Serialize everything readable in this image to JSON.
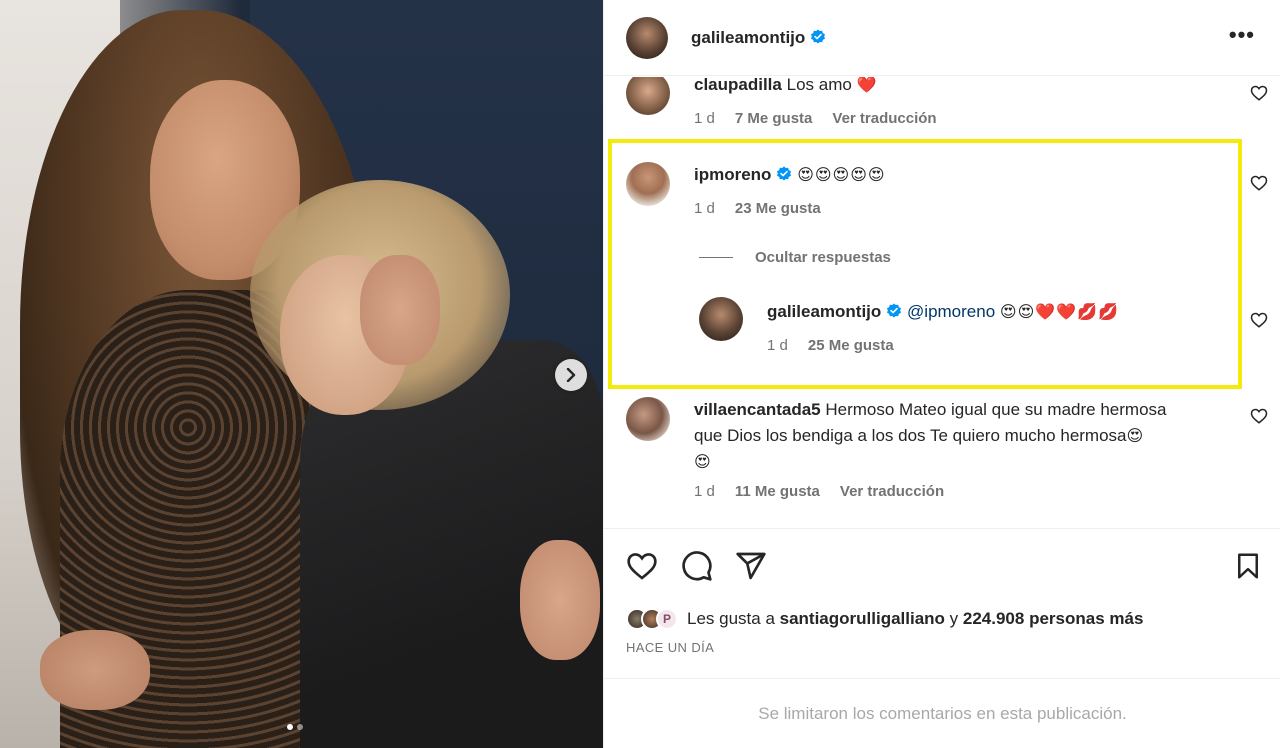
{
  "post": {
    "image_alt": "Photo of woman hugging child",
    "carousel_total": 2,
    "carousel_index": 1
  },
  "header": {
    "username": "galileamontijo",
    "verified": true,
    "more_label": "•••"
  },
  "comments": [
    {
      "username": "claupadilla",
      "text": "Los amo ",
      "emoji": "❤️",
      "age": "1 d",
      "likes": "7 Me gusta",
      "translate": "Ver traducción"
    },
    {
      "username": "ipmoreno",
      "verified": true,
      "text": "",
      "emoji": "😍😍😍😍😍",
      "age": "1 d",
      "likes": "23 Me gusta"
    },
    {
      "username": "galileamontijo",
      "verified": true,
      "mention": "@ipmoreno",
      "emoji": "😍😍❤️❤️💋💋",
      "age": "1 d",
      "likes": "25 Me gusta"
    },
    {
      "username": "villaencantada5",
      "text_line1": "Hermoso Mateo igual que su madre hermosa",
      "text_line2": "que Dios los bendiga a los dos Te quiero mucho hermosa",
      "emoji_end": "😍",
      "emoji_line3": "😍",
      "age": "1 d",
      "likes": "11 Me gusta",
      "translate": "Ver traducción"
    }
  ],
  "hide_replies": "Ocultar respuestas",
  "likes": {
    "prefix": "Les gusta a ",
    "user": "santiagorulligalliano",
    "middle": " y ",
    "count": "224.908 personas más"
  },
  "date": "HACE UN DÍA",
  "footer": "Se limitaron los comentarios en esta publicación.",
  "colors": {
    "highlight": "#f4ea0c",
    "verified": "#0095f6",
    "like_red": "#ed4956"
  }
}
